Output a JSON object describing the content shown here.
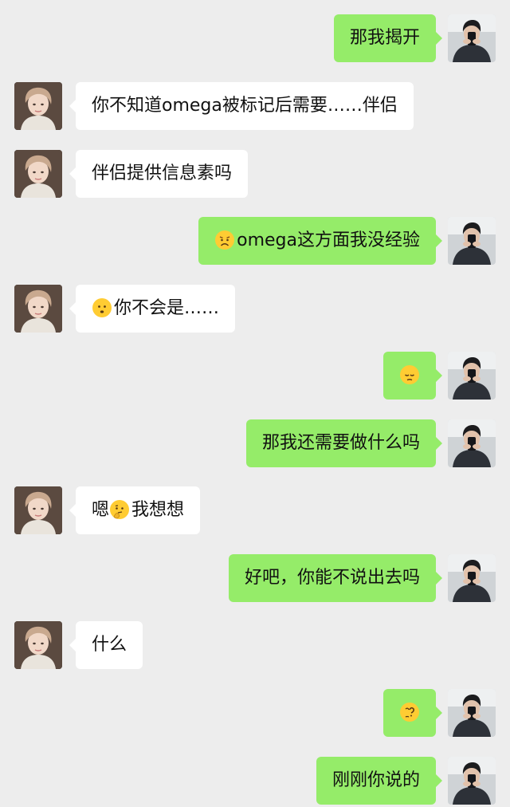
{
  "colors": {
    "background": "#ededed",
    "incoming_bubble": "#ffffff",
    "outgoing_bubble": "#95ec69"
  },
  "messages": [
    {
      "dir": "out",
      "text": "那我揭开",
      "emoji": ""
    },
    {
      "dir": "in",
      "text": "你不知道omega被标记后需要……伴侣",
      "emoji": ""
    },
    {
      "dir": "in",
      "text": "伴侣提供信息素吗",
      "emoji": ""
    },
    {
      "dir": "out",
      "text": "omega这方面我没经验",
      "emoji": "worried-face-emoji"
    },
    {
      "dir": "in",
      "text": "你不会是……",
      "emoji": "hushed-face-emoji"
    },
    {
      "dir": "out",
      "text": "",
      "emoji": "pensive-face-emoji"
    },
    {
      "dir": "out",
      "text": "那我还需要做什么吗",
      "emoji": ""
    },
    {
      "dir": "in",
      "text": "我想想",
      "emoji": "thinking-face-emoji",
      "prefix": "嗯"
    },
    {
      "dir": "out",
      "text": "好吧，你能不说出去吗",
      "emoji": ""
    },
    {
      "dir": "in",
      "text": "什么",
      "emoji": ""
    },
    {
      "dir": "out",
      "text": "",
      "emoji": "confused-face-emoji"
    },
    {
      "dir": "out",
      "text": "刚刚你说的",
      "emoji": ""
    }
  ]
}
